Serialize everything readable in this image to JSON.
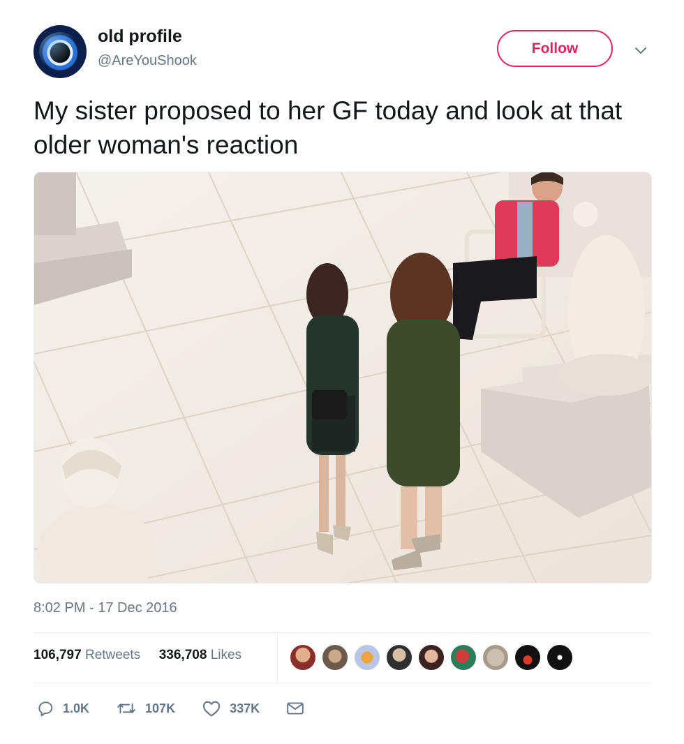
{
  "user": {
    "display_name": "old profile",
    "handle": "@AreYouShook"
  },
  "follow_label": "Follow",
  "tweet_text": "My sister proposed to her GF today and look at that older woman's reaction",
  "timestamp": "8:02 PM - 17 Dec 2016",
  "stats": {
    "retweets_count": "106,797",
    "retweets_label": "Retweets",
    "likes_count": "336,708",
    "likes_label": "Likes"
  },
  "actions": {
    "reply_count": "1.0K",
    "retweet_count": "107K",
    "like_count": "337K"
  },
  "colors": {
    "accent": "#e0245e",
    "secondary_text": "#657786",
    "divider": "#e6ecf0"
  },
  "icons": [
    "avatar",
    "chevron-down-icon",
    "reply-icon",
    "retweet-icon",
    "like-icon",
    "message-icon"
  ]
}
